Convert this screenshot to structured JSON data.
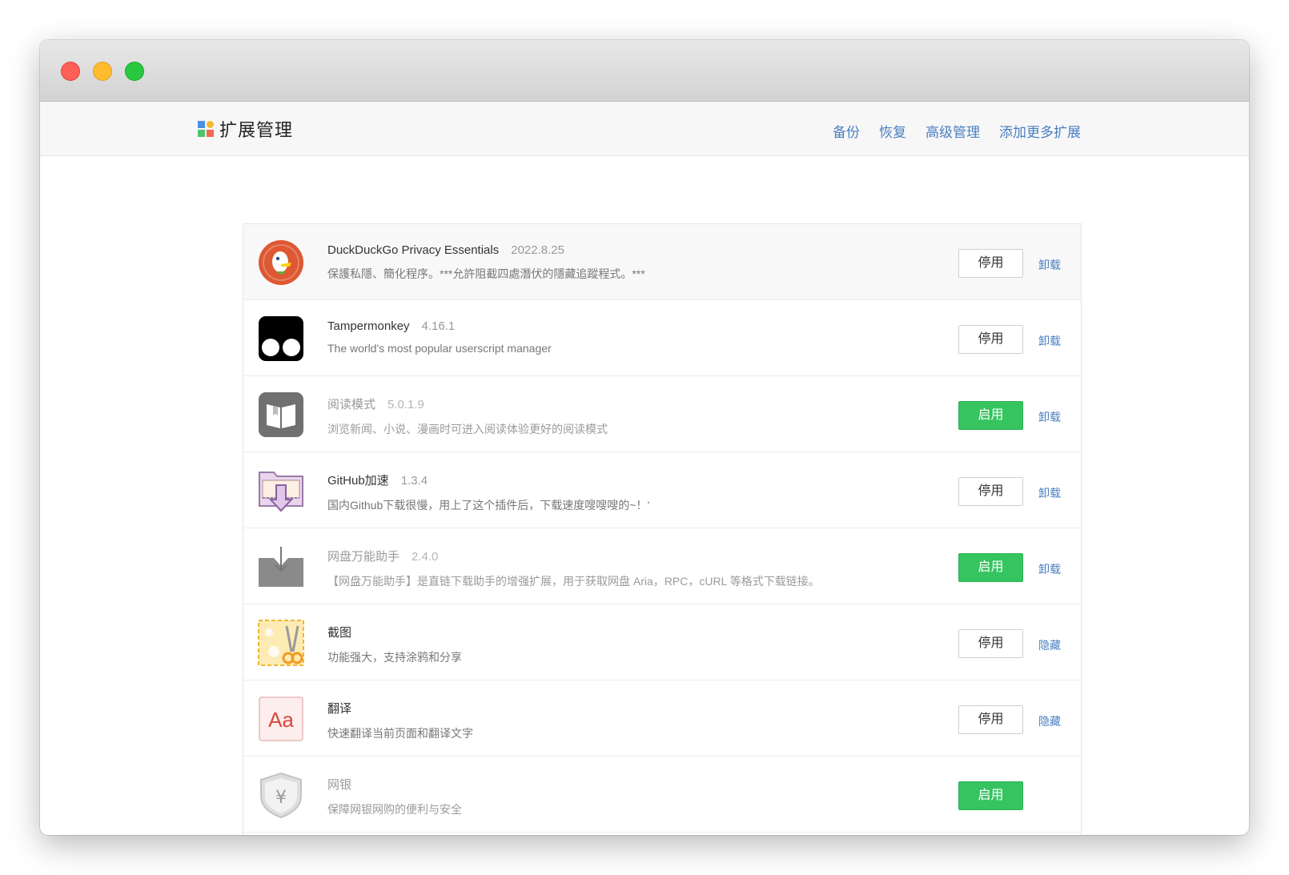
{
  "header": {
    "title": "扩展管理",
    "nav": [
      "备份",
      "恢复",
      "高级管理",
      "添加更多扩展"
    ]
  },
  "colors": {
    "link": "#4a7fc1",
    "enable_button": "#35c45f"
  },
  "extensions": [
    {
      "name": "DuckDuckGo Privacy Essentials",
      "version": "2022.8.25",
      "description": "保護私隱、簡化程序。***允許阻截四處潛伏的隱藏追蹤程式。***",
      "button": "停用",
      "link": "卸载",
      "icon": "duckduckgo-icon",
      "state": "enabled"
    },
    {
      "name": "Tampermonkey",
      "version": "4.16.1",
      "description": "The world's most popular userscript manager",
      "button": "停用",
      "link": "卸载",
      "icon": "tampermonkey-icon",
      "state": "enabled"
    },
    {
      "name": "阅读模式",
      "version": "5.0.1.9",
      "description": "浏览新闻、小说、漫画时可进入阅读体验更好的阅读模式",
      "button": "启用",
      "link": "卸载",
      "icon": "reader-mode-icon",
      "state": "disabled"
    },
    {
      "name": "GitHub加速",
      "version": "1.3.4",
      "description": "国内Github下载很慢，用上了这个插件后，下载速度嗖嗖嗖的~！’",
      "button": "停用",
      "link": "卸载",
      "icon": "github-accelerator-icon",
      "state": "enabled"
    },
    {
      "name": "网盘万能助手",
      "version": "2.4.0",
      "description": "【网盘万能助手】是直链下载助手的增强扩展，用于获取网盘 Aria，RPC，cURL 等格式下载链接。",
      "button": "启用",
      "link": "卸载",
      "icon": "netdisk-helper-icon",
      "state": "disabled"
    },
    {
      "name": "截图",
      "version": "",
      "description": "功能强大，支持涂鸦和分享",
      "button": "停用",
      "link": "隐藏",
      "icon": "screenshot-scissors-icon",
      "state": "enabled"
    },
    {
      "name": "翻译",
      "version": "",
      "description": "快速翻译当前页面和翻译文字",
      "button": "停用",
      "link": "隐藏",
      "icon": "translate-aa-icon",
      "state": "enabled"
    },
    {
      "name": "网银",
      "version": "",
      "description": "保障网银网购的便利与安全",
      "button": "启用",
      "link": "",
      "icon": "online-bank-shield-icon",
      "state": "disabled"
    }
  ]
}
